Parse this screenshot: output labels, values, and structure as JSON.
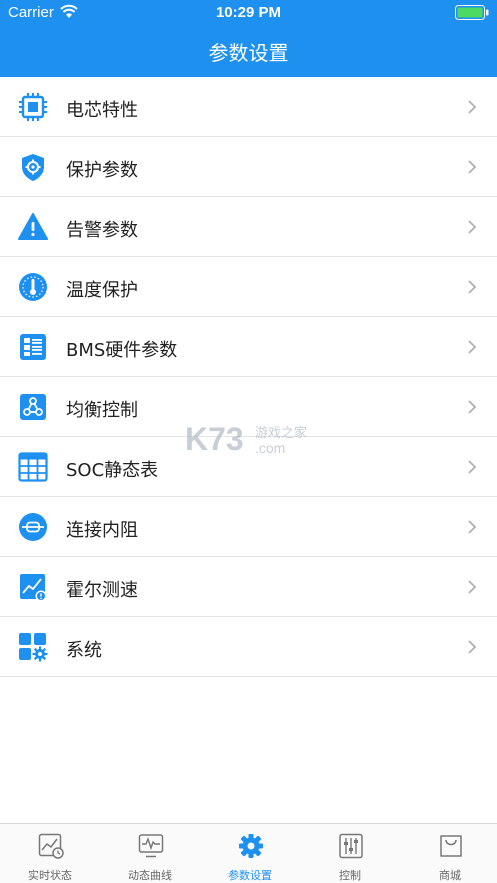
{
  "status_bar": {
    "carrier": "Carrier",
    "time": "10:29 PM"
  },
  "header": {
    "title": "参数设置"
  },
  "menu": {
    "items": [
      {
        "label": "电芯特性",
        "icon": "cell-chip-icon"
      },
      {
        "label": "保护参数",
        "icon": "shield-gear-icon"
      },
      {
        "label": "告警参数",
        "icon": "warning-icon"
      },
      {
        "label": "温度保护",
        "icon": "thermometer-gauge-icon"
      },
      {
        "label": "BMS硬件参数",
        "icon": "list-document-icon"
      },
      {
        "label": "均衡控制",
        "icon": "network-nodes-icon"
      },
      {
        "label": "SOC静态表",
        "icon": "grid-table-icon"
      },
      {
        "label": "连接内阻",
        "icon": "resistor-icon"
      },
      {
        "label": "霍尔测速",
        "icon": "trend-chart-icon"
      },
      {
        "label": "系统",
        "icon": "apps-gear-icon"
      }
    ]
  },
  "tabs": [
    {
      "label": "实时状态",
      "icon": "realtime-chart-icon",
      "active": false
    },
    {
      "label": "动态曲线",
      "icon": "monitor-curve-icon",
      "active": false
    },
    {
      "label": "参数设置",
      "icon": "gear-icon",
      "active": true
    },
    {
      "label": "控制",
      "icon": "sliders-icon",
      "active": false
    },
    {
      "label": "商城",
      "icon": "shopping-bag-icon",
      "active": false
    }
  ],
  "watermark": {
    "text": "游戏之家",
    "brand": "K73",
    "domain": ".com"
  },
  "colors": {
    "accent": "#1e90f0",
    "divider": "#e4e4e4",
    "tab_inactive": "#666666"
  }
}
